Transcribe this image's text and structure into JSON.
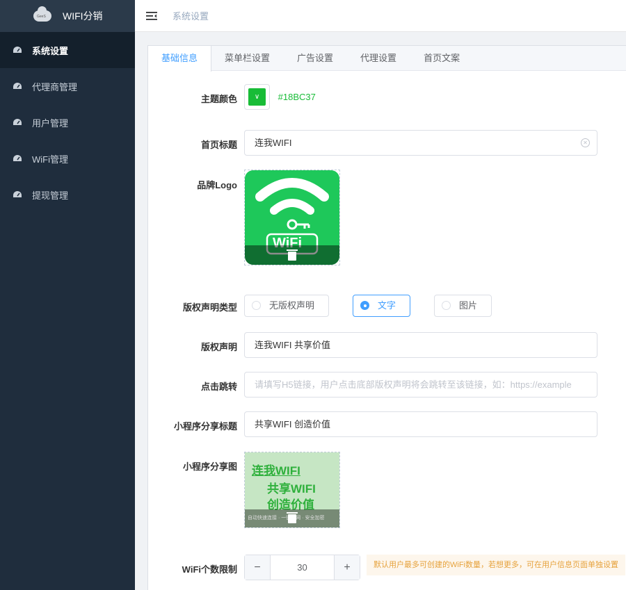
{
  "app": {
    "brand_name": "WIFI分销",
    "logo_text": "GeeS"
  },
  "sidebar": {
    "items": [
      {
        "label": "系统设置",
        "icon": "gauge-icon",
        "active": true
      },
      {
        "label": "代理商管理",
        "icon": "gauge-icon",
        "active": false
      },
      {
        "label": "用户管理",
        "icon": "gauge-icon",
        "active": false
      },
      {
        "label": "WiFi管理",
        "icon": "gauge-icon",
        "active": false
      },
      {
        "label": "提现管理",
        "icon": "gauge-icon",
        "active": false
      }
    ]
  },
  "header": {
    "breadcrumb": "系统设置",
    "menu_icon": "menu-fold-icon"
  },
  "tabs": [
    {
      "label": "基础信息",
      "active": true
    },
    {
      "label": "菜单栏设置",
      "active": false
    },
    {
      "label": "广告设置",
      "active": false
    },
    {
      "label": "代理设置",
      "active": false
    },
    {
      "label": "首页文案",
      "active": false
    }
  ],
  "form": {
    "theme_color": {
      "label": "主题颜色",
      "value": "#18BC37",
      "color": "#18BC37"
    },
    "home_title": {
      "label": "首页标题",
      "value": "连我WIFI"
    },
    "brand_logo": {
      "label": "品牌Logo",
      "image_text": "WiFi"
    },
    "copyright_type": {
      "label": "版权声明类型",
      "options": [
        {
          "label": "无版权声明",
          "checked": false
        },
        {
          "label": "文字",
          "checked": true
        },
        {
          "label": "图片",
          "checked": false
        }
      ]
    },
    "copyright": {
      "label": "版权声明",
      "value": "连我WIFI 共享价值"
    },
    "click_jump": {
      "label": "点击跳转",
      "value": "",
      "placeholder": "请填写H5链接，用户点击底部版权声明将会跳转至该链接，如：https://example"
    },
    "share_title": {
      "label": "小程序分享标题",
      "value": "共享WIFI 创造价值"
    },
    "share_image": {
      "label": "小程序分享图",
      "line1": "连我WIFI",
      "line2": "共享WIFI",
      "line3": "创造价值",
      "footer": "自动快速连接 · 一键上网 · 安全加密"
    },
    "wifi_limit": {
      "label": "WiFi个数限制",
      "value": "30",
      "minus": "−",
      "plus": "+",
      "tip": "默认用户最多可创建的WiFi数量，若想更多，可在用户信息页面单独设置"
    }
  }
}
